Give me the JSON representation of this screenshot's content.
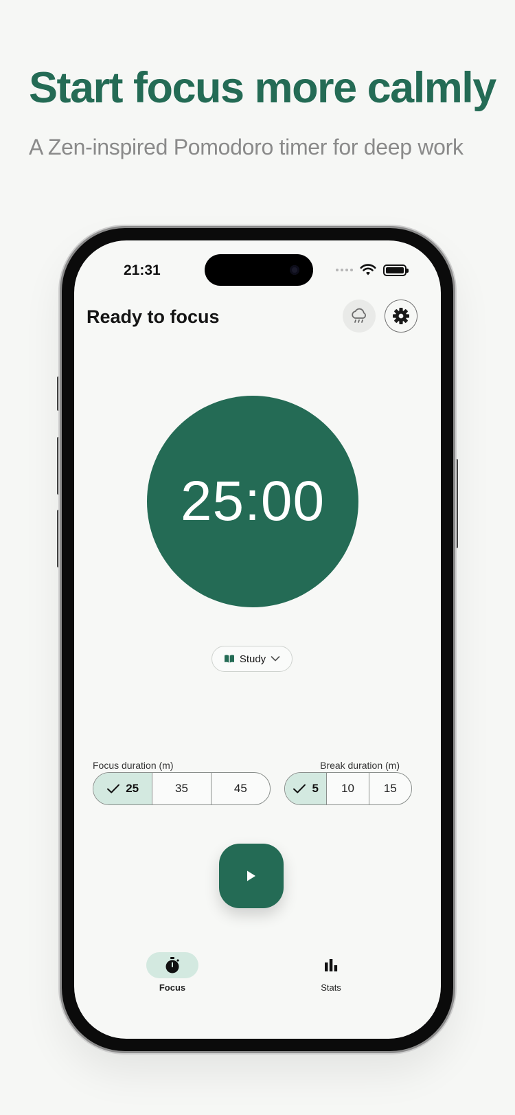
{
  "marketing": {
    "headline": "Start focus more calmly",
    "subheadline": "A Zen-inspired Pomodoro timer for deep work"
  },
  "status_bar": {
    "time": "21:31",
    "icons": [
      "signal-dots-icon",
      "wifi-icon",
      "battery-icon"
    ]
  },
  "header": {
    "title": "Ready to focus",
    "weather_icon": "rain-cloud-icon",
    "settings_icon": "gear-icon"
  },
  "timer": {
    "display": "25:00",
    "color": "#246b55"
  },
  "category": {
    "icon": "book-icon",
    "label": "Study",
    "chevron": "chevron-down-icon"
  },
  "focus_duration": {
    "label": "Focus duration (m)",
    "options": [
      "25",
      "35",
      "45"
    ],
    "selected": "25"
  },
  "break_duration": {
    "label": "Break duration (m)",
    "options": [
      "5",
      "10",
      "15"
    ],
    "selected": "5"
  },
  "play_button": {
    "icon": "play-icon"
  },
  "tabs": [
    {
      "label": "Focus",
      "icon": "stopwatch-icon",
      "active": true
    },
    {
      "label": "Stats",
      "icon": "bar-chart-icon",
      "active": false
    }
  ],
  "colors": {
    "accent": "#246b55",
    "accent_light": "#d3e9e0",
    "subtle_text": "#8a8a8a"
  }
}
